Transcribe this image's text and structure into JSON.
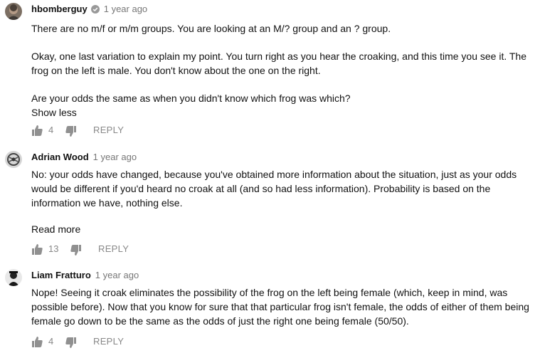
{
  "comments": [
    {
      "author": "hbomberguy",
      "time": "1 year ago",
      "verified": true,
      "paragraphs": [
        "There are no m/f or m/m groups. You are looking at an M/? group and an ? group.",
        "Okay, one last variation to explain my point. You turn right as you hear the croaking, and this time you see it. The frog on the left is male. You don't know about the one on the right.",
        "Are your odds the same as when you didn't know which frog was which?"
      ],
      "toggle": "Show less",
      "likes": "4",
      "reply": "REPLY",
      "avatar_icon": "hbomberguy-avatar-icon"
    },
    {
      "author": "Adrian Wood",
      "time": "1 year ago",
      "verified": false,
      "paragraphs": [
        "No: your odds have changed, because you've obtained more information about the situation, just as your odds would be different if you'd heard no croak at all (and so had less information). Probability is based on the information we have, nothing else."
      ],
      "toggle": "Read more",
      "likes": "13",
      "reply": "REPLY",
      "avatar_icon": "adrian-wood-avatar-icon"
    },
    {
      "author": "Liam Fratturo",
      "time": "1 year ago",
      "verified": false,
      "paragraphs": [
        "Nope!  Seeing it croak eliminates the possibility of the frog on the left being female (which, keep in mind, was possible before).  Now that you know for sure that that particular frog isn't female, the odds of either of them being female go down to be the same as the odds of just the right one being female (50/50)."
      ],
      "likes": "4",
      "reply": "REPLY",
      "avatar_icon": "liam-fratturo-avatar-icon"
    }
  ],
  "icons": {
    "like": "thumbs-up-icon",
    "dislike": "thumbs-down-icon",
    "verified": "verified-check-icon"
  },
  "colors": {
    "text": "#111111",
    "meta": "#777777",
    "actions": "#888888"
  }
}
